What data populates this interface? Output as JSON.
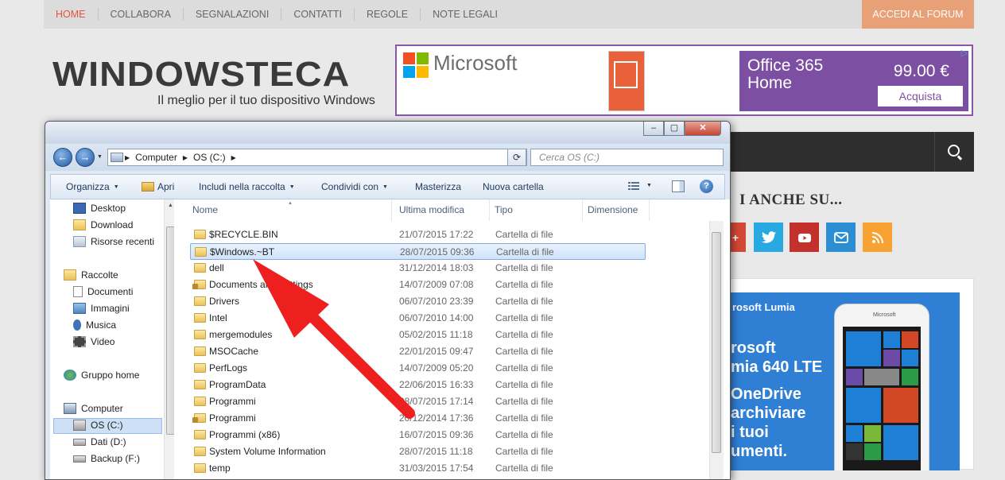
{
  "site": {
    "nav": [
      "HOME",
      "COLLABORA",
      "SEGNALAZIONI",
      "CONTATTI",
      "REGOLE",
      "NOTE LEGALI"
    ],
    "forum_button": "ACCEDI AL FORUM",
    "logo": "WINDOWSTECA",
    "tagline": "Il meglio per il tuo dispositivo Windows",
    "follow_heading": "I ANCHE SU...",
    "social": [
      "google-plus-icon",
      "twitter-icon",
      "youtube-icon",
      "email-icon",
      "rss-icon"
    ],
    "colors": {
      "accent": "#e4543d",
      "forum": "#e8a077",
      "dark_bar": "#2e2e2e"
    }
  },
  "ad": {
    "brand": "Microsoft",
    "product_line1": "Office 365",
    "product_line2": "Home",
    "price": "99.00 €",
    "cta": "Acquista",
    "color": "#7c4fa3"
  },
  "widget": {
    "line1": "rosoft Lumia",
    "line2": "rosoft",
    "line3": "mia 640 LTE",
    "line4": "OneDrive",
    "line5": "archiviare",
    "line6": "i tuoi",
    "line7": "umenti.",
    "phone_brand": "Microsoft"
  },
  "explorer": {
    "breadcrumb": [
      "Computer",
      "OS (C:)"
    ],
    "search_placeholder": "Cerca OS (C:)",
    "toolbar": {
      "organize": "Organizza",
      "open": "Apri",
      "include": "Includi nella raccolta",
      "share": "Condividi con",
      "burn": "Masterizza",
      "new_folder": "Nuova cartella"
    },
    "nav": {
      "desktop": "Desktop",
      "download": "Download",
      "recent": "Risorse recenti",
      "libraries": "Raccolte",
      "documents": "Documenti",
      "images": "Immagini",
      "music": "Musica",
      "video": "Video",
      "homegroup": "Gruppo home",
      "computer": "Computer",
      "os": "OS (C:)",
      "data": "Dati (D:)",
      "backup": "Backup (F:)"
    },
    "columns": [
      "Nome",
      "Ultima modifica",
      "Tipo",
      "Dimensione"
    ],
    "files": [
      {
        "name": "$RECYCLE.BIN",
        "date": "21/07/2015 17:22",
        "type": "Cartella di file"
      },
      {
        "name": "$Windows.~BT",
        "date": "28/07/2015 09:36",
        "type": "Cartella di file"
      },
      {
        "name": "dell",
        "date": "31/12/2014 18:03",
        "type": "Cartella di file"
      },
      {
        "name": "Documents and Settings",
        "date": "14/07/2009 07:08",
        "type": "Cartella di file"
      },
      {
        "name": "Drivers",
        "date": "06/07/2010 23:39",
        "type": "Cartella di file"
      },
      {
        "name": "Intel",
        "date": "06/07/2010 14:00",
        "type": "Cartella di file"
      },
      {
        "name": "mergemodules",
        "date": "05/02/2015 11:18",
        "type": "Cartella di file"
      },
      {
        "name": "MSOCache",
        "date": "22/01/2015 09:47",
        "type": "Cartella di file"
      },
      {
        "name": "PerfLogs",
        "date": "14/07/2009 05:20",
        "type": "Cartella di file"
      },
      {
        "name": "ProgramData",
        "date": "22/06/2015 16:33",
        "type": "Cartella di file"
      },
      {
        "name": "Programmi",
        "date": "08/07/2015 17:14",
        "type": "Cartella di file"
      },
      {
        "name": "Programmi",
        "date": "20/12/2014 17:36",
        "type": "Cartella di file"
      },
      {
        "name": "Programmi (x86)",
        "date": "16/07/2015 09:36",
        "type": "Cartella di file"
      },
      {
        "name": "System Volume Information",
        "date": "28/07/2015 11:18",
        "type": "Cartella di file"
      },
      {
        "name": "temp",
        "date": "31/03/2015 17:54",
        "type": "Cartella di file"
      }
    ]
  }
}
